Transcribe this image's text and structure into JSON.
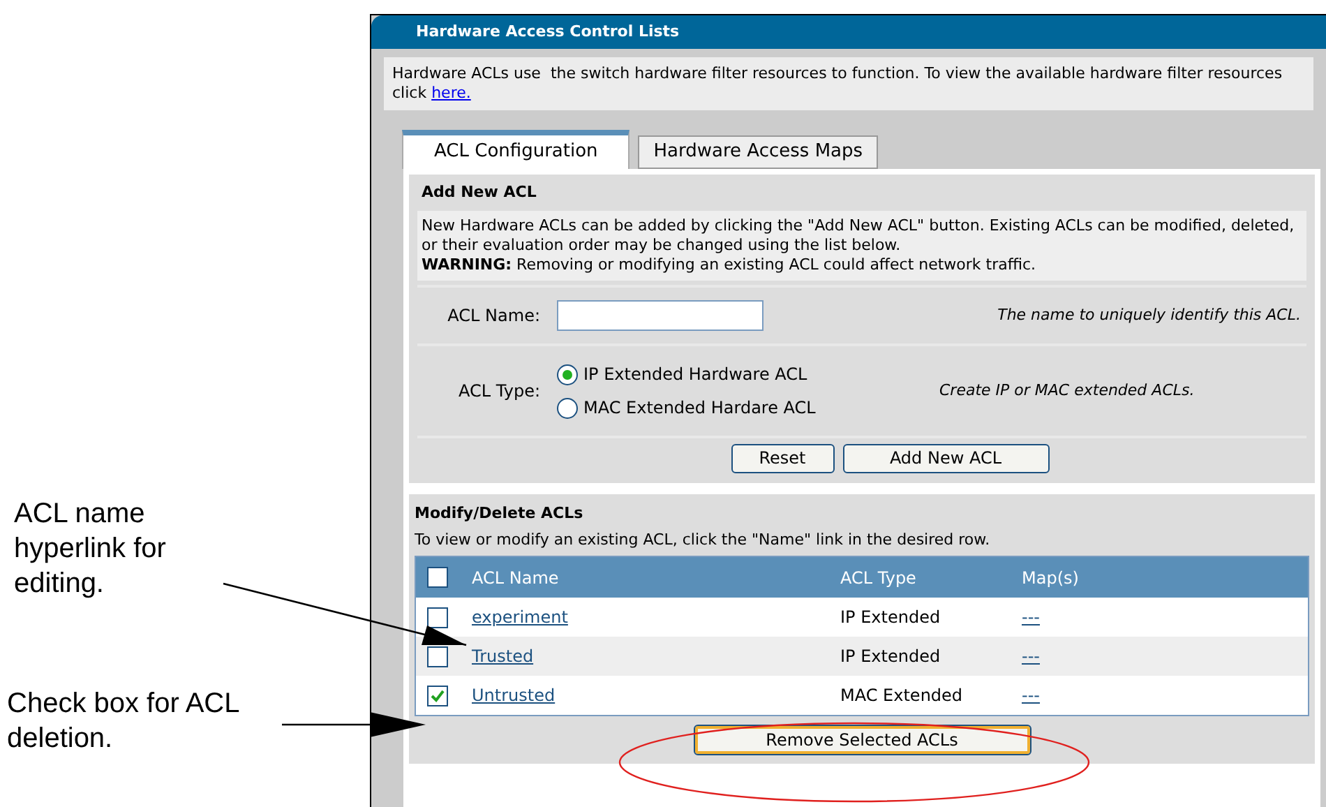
{
  "title": "Hardware Access Control Lists",
  "intro": {
    "text": "Hardware ACLs use  the switch hardware filter resources to function. To view the available hardware filter resources click",
    "link": "here."
  },
  "tabs": [
    {
      "label": "ACL Configuration",
      "selected": true
    },
    {
      "label": "Hardware Access Maps",
      "selected": false
    }
  ],
  "add_section": {
    "heading": "Add New ACL",
    "description": "New Hardware ACLs can be added by clicking the \"Add New ACL\" button. Existing ACLs can be modified, deleted, or their evaluation order may be changed using the list below.",
    "warning": "**WARNING:** Removing or modifying an existing ACL could affect network traffic."
  },
  "name_field": {
    "label": "ACL Name:",
    "hint": "The name to uniquely identify this ACL."
  },
  "type_field": {
    "label": "ACL Type:",
    "options": [
      {
        "label": "IP Extended Hardware ACL",
        "selected": true
      },
      {
        "label": "MAC Extended Hardare ACL",
        "selected": false
      }
    ],
    "hint": "Create IP or MAC extended ACLs."
  },
  "buttons": [
    "Reset",
    "Add New ACL"
  ],
  "modify_section": {
    "heading": "Modify/Delete ACLs",
    "description": "To view or modify an existing ACL, click the \"Name\" link in the desired row."
  },
  "table": {
    "columns": [
      "ACL Name",
      "ACL Type",
      "Map(s)"
    ],
    "select_all_checked": false,
    "rows": [
      {
        "name": "experiment",
        "type": "IP Extended",
        "maps": "---",
        "checked": false
      },
      {
        "name": "Trusted",
        "type": "IP Extended",
        "maps": "---",
        "checked": false
      },
      {
        "name": "Untrusted",
        "type": "MAC Extended",
        "maps": "---",
        "checked": true
      }
    ]
  },
  "remove_button": "Remove Selected ACLs",
  "callouts": [
    "ACL name hyperlink for editing.",
    "Check box for ACL deletion."
  ]
}
